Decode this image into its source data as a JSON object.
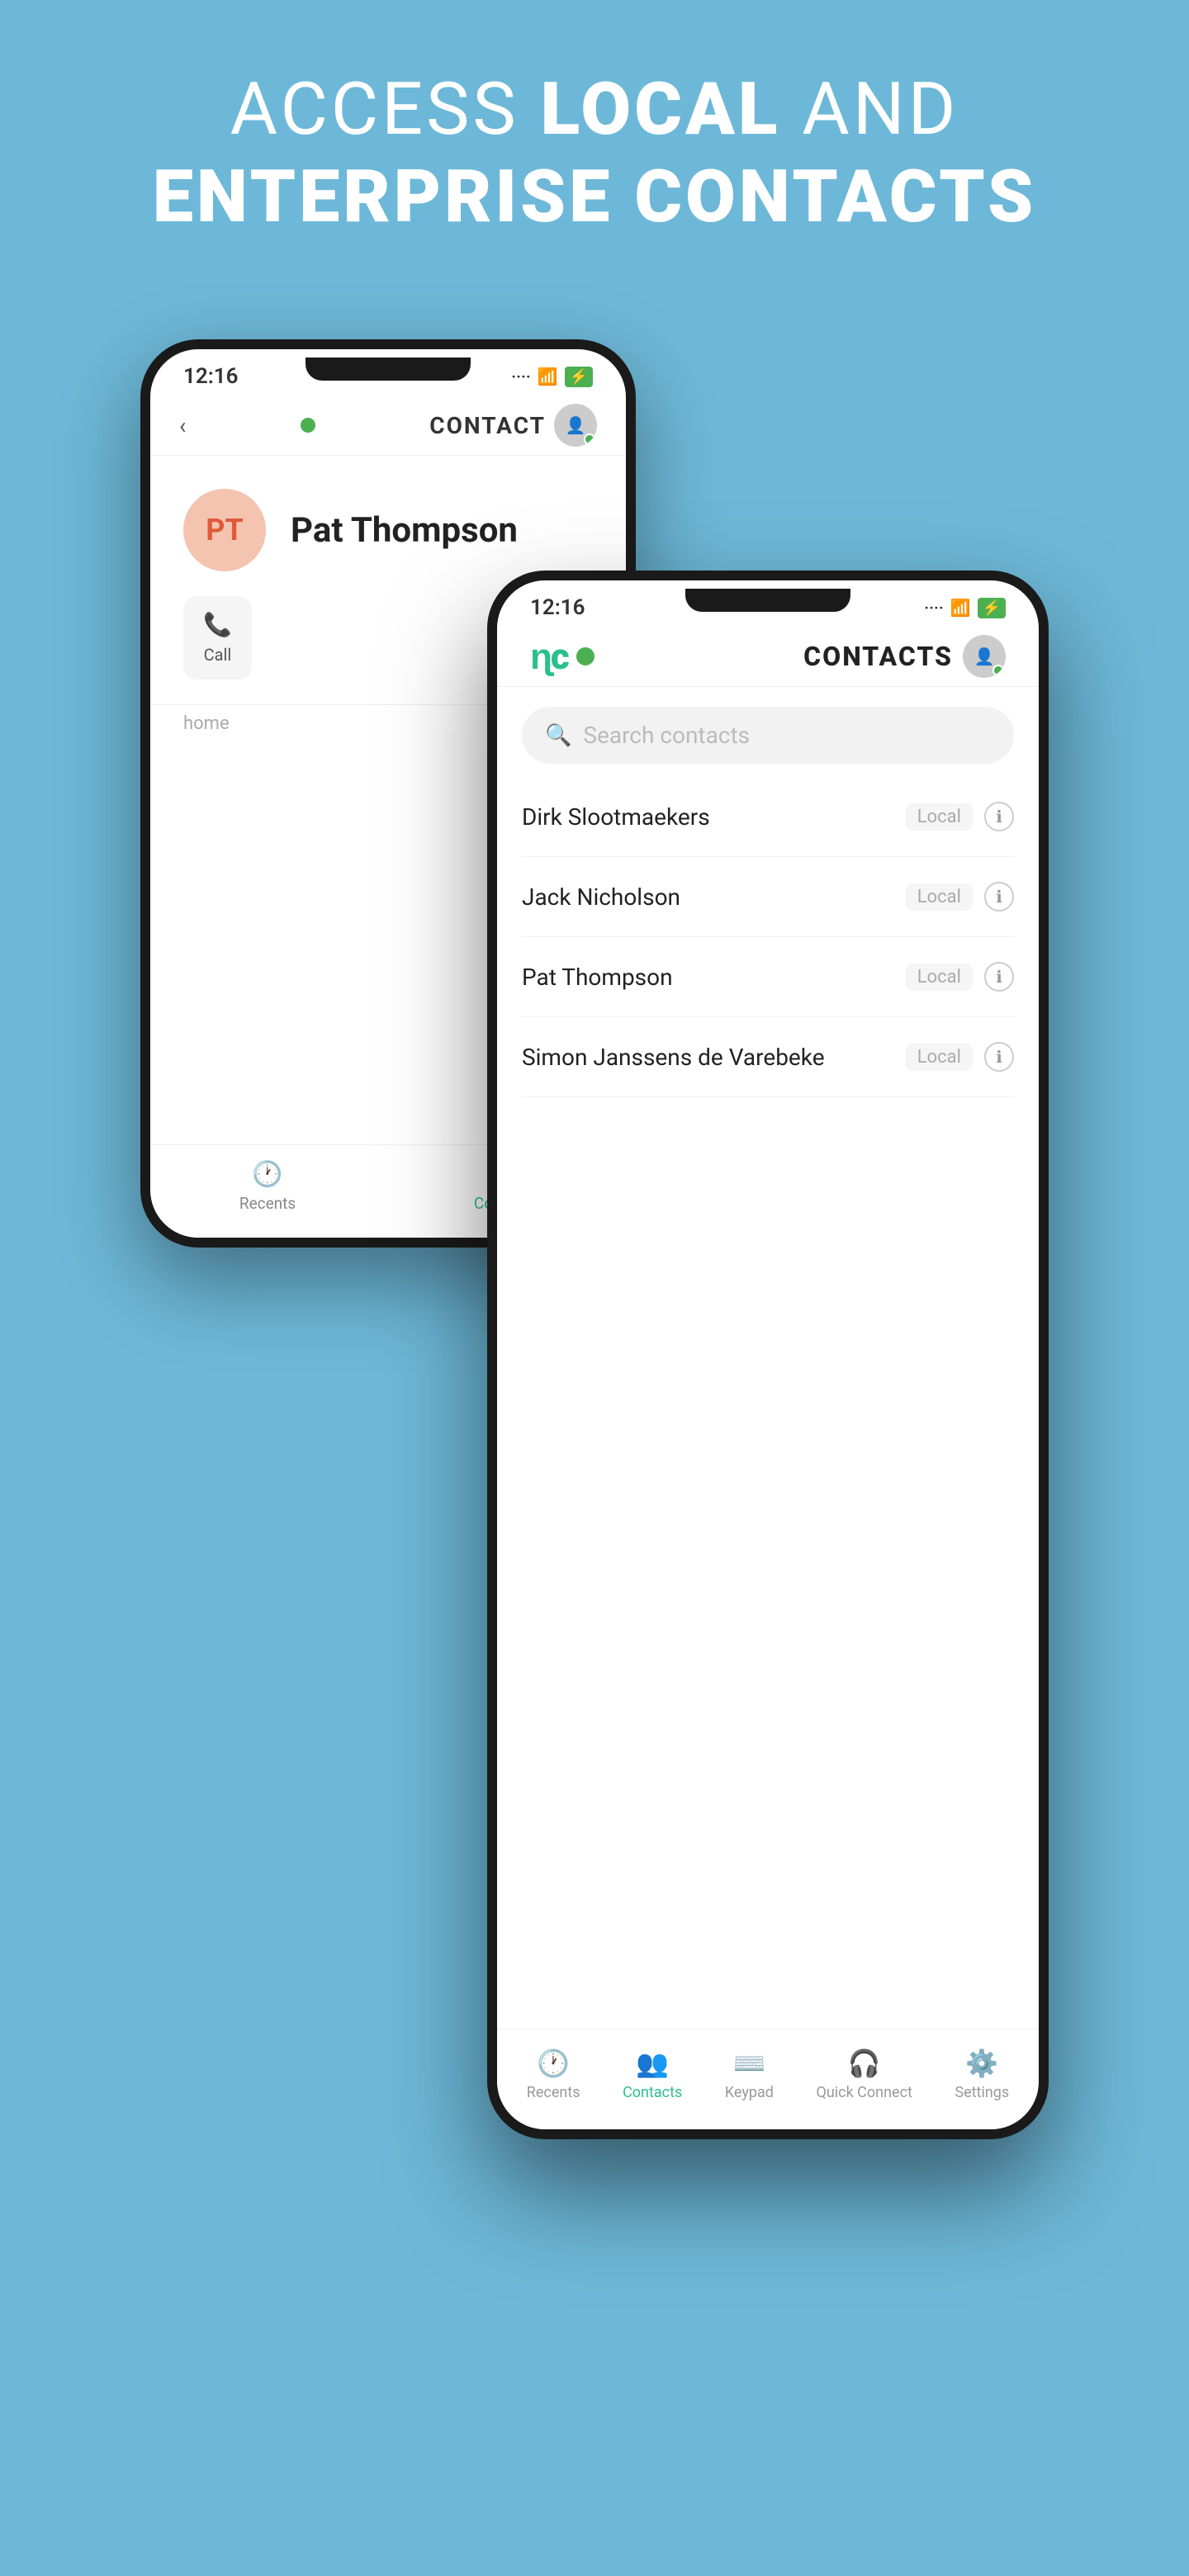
{
  "hero": {
    "line1_normal": "ACCESS ",
    "line1_bold": "LOCAL",
    "line1_end": " AND",
    "line2": "ENTERPRISE CONTACTS"
  },
  "back_phone": {
    "status_time": "12:16",
    "nav_title": "CONTACT",
    "contact_initials": "PT",
    "contact_name": "Pat Thompson",
    "call_label": "Call",
    "section_home": "home",
    "nav_recents": "Recents",
    "nav_contacts": "Contacts"
  },
  "front_phone": {
    "status_time": "12:16",
    "nav_title": "CONTACTS",
    "search_placeholder": "Search contacts",
    "contacts": [
      {
        "name": "Dirk Slootmaekers",
        "badge": "Local"
      },
      {
        "name": "Jack Nicholson",
        "badge": "Local"
      },
      {
        "name": "Pat Thompson",
        "badge": "Local"
      },
      {
        "name": "Simon Janssens de Varebeke",
        "badge": "Local"
      }
    ],
    "nav_recents": "Recents",
    "nav_contacts": "Contacts",
    "nav_keypad": "Keypad",
    "nav_quickconnect": "Quick Connect",
    "nav_settings": "Settings"
  },
  "colors": {
    "background": "#6db8d8",
    "accent": "#2bbf8e",
    "online": "#4caf50",
    "avatar_bg": "#f4c4b0",
    "avatar_text": "#e05a3a"
  }
}
